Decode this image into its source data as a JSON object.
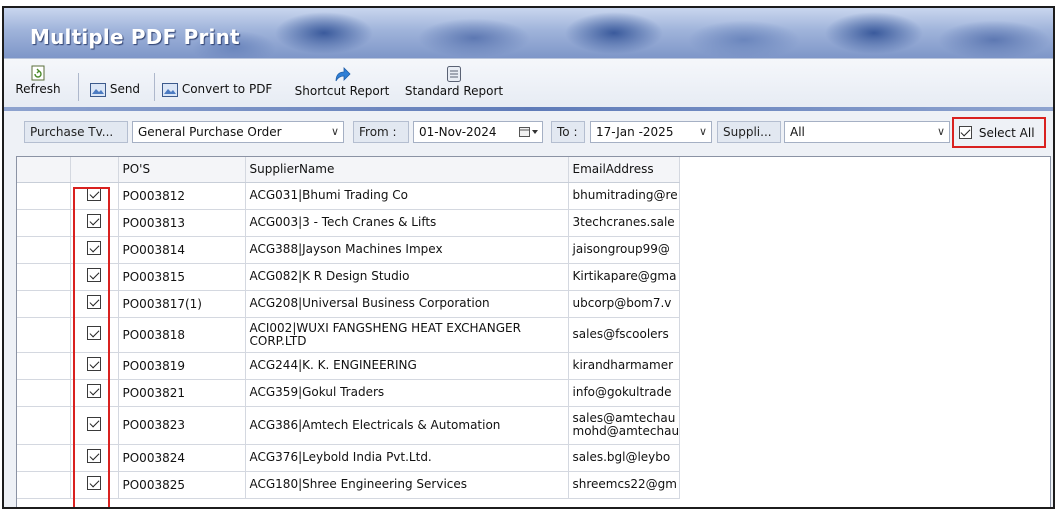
{
  "window": {
    "title": "Multiple PDF Print"
  },
  "toolbar": {
    "refresh_label": "Refresh",
    "send_label": "Send",
    "convert_label": "Convert to PDF",
    "shortcut_label": "Shortcut Report",
    "standard_label": "Standard Report"
  },
  "filters": {
    "purchase_type_label": "Purchase Tv...",
    "purchase_type_value": "General Purchase Order",
    "from_label": "From :",
    "from_value": "01-Nov-2024",
    "to_label": "To :",
    "to_value": "17-Jan -2025",
    "supplier_label": "Suppli...",
    "supplier_value": "All",
    "select_all_label": "Select All",
    "select_all_checked": true
  },
  "grid": {
    "columns": [
      "",
      "PO'S",
      "SupplierName",
      "EmailAddress"
    ],
    "rows": [
      {
        "checked": true,
        "po": "PO003812",
        "supplier": "ACG031|Bhumi Trading Co",
        "email": "bhumitrading@re"
      },
      {
        "checked": true,
        "po": "PO003813",
        "supplier": "ACG003|3 - Tech Cranes & Lifts",
        "email": "3techcranes.sale"
      },
      {
        "checked": true,
        "po": "PO003814",
        "supplier": "ACG388|Jayson Machines Impex",
        "email": "jaisongroup99@"
      },
      {
        "checked": true,
        "po": "PO003815",
        "supplier": "ACG082|K R Design Studio",
        "email": "Kirtikapare@gma"
      },
      {
        "checked": true,
        "po": "PO003817(1)",
        "supplier": "ACG208|Universal Business Corporation",
        "email": "ubcorp@bom7.v"
      },
      {
        "checked": true,
        "po": "PO003818",
        "supplier": "ACI002|WUXI FANGSHENG HEAT EXCHANGER CORP.LTD",
        "email": "sales@fscoolers"
      },
      {
        "checked": true,
        "po": "PO003819",
        "supplier": "ACG244|K. K. ENGINEERING",
        "email": "kirandharmamer"
      },
      {
        "checked": true,
        "po": "PO003821",
        "supplier": "ACG359|Gokul Traders",
        "email": "info@gokultrade"
      },
      {
        "checked": true,
        "po": "PO003823",
        "supplier": "ACG386|Amtech Electricals & Automation",
        "email": "sales@amtechau mohd@amtechau"
      },
      {
        "checked": true,
        "po": "PO003824",
        "supplier": "ACG376|Leybold India Pvt.Ltd.",
        "email": "sales.bgl@leybo"
      },
      {
        "checked": true,
        "po": "PO003825",
        "supplier": "ACG180|Shree Engineering Services",
        "email": "shreemcs22@gm"
      }
    ]
  },
  "colors": {
    "highlight": "#d9211f",
    "title_bg": "#7e96c8"
  }
}
